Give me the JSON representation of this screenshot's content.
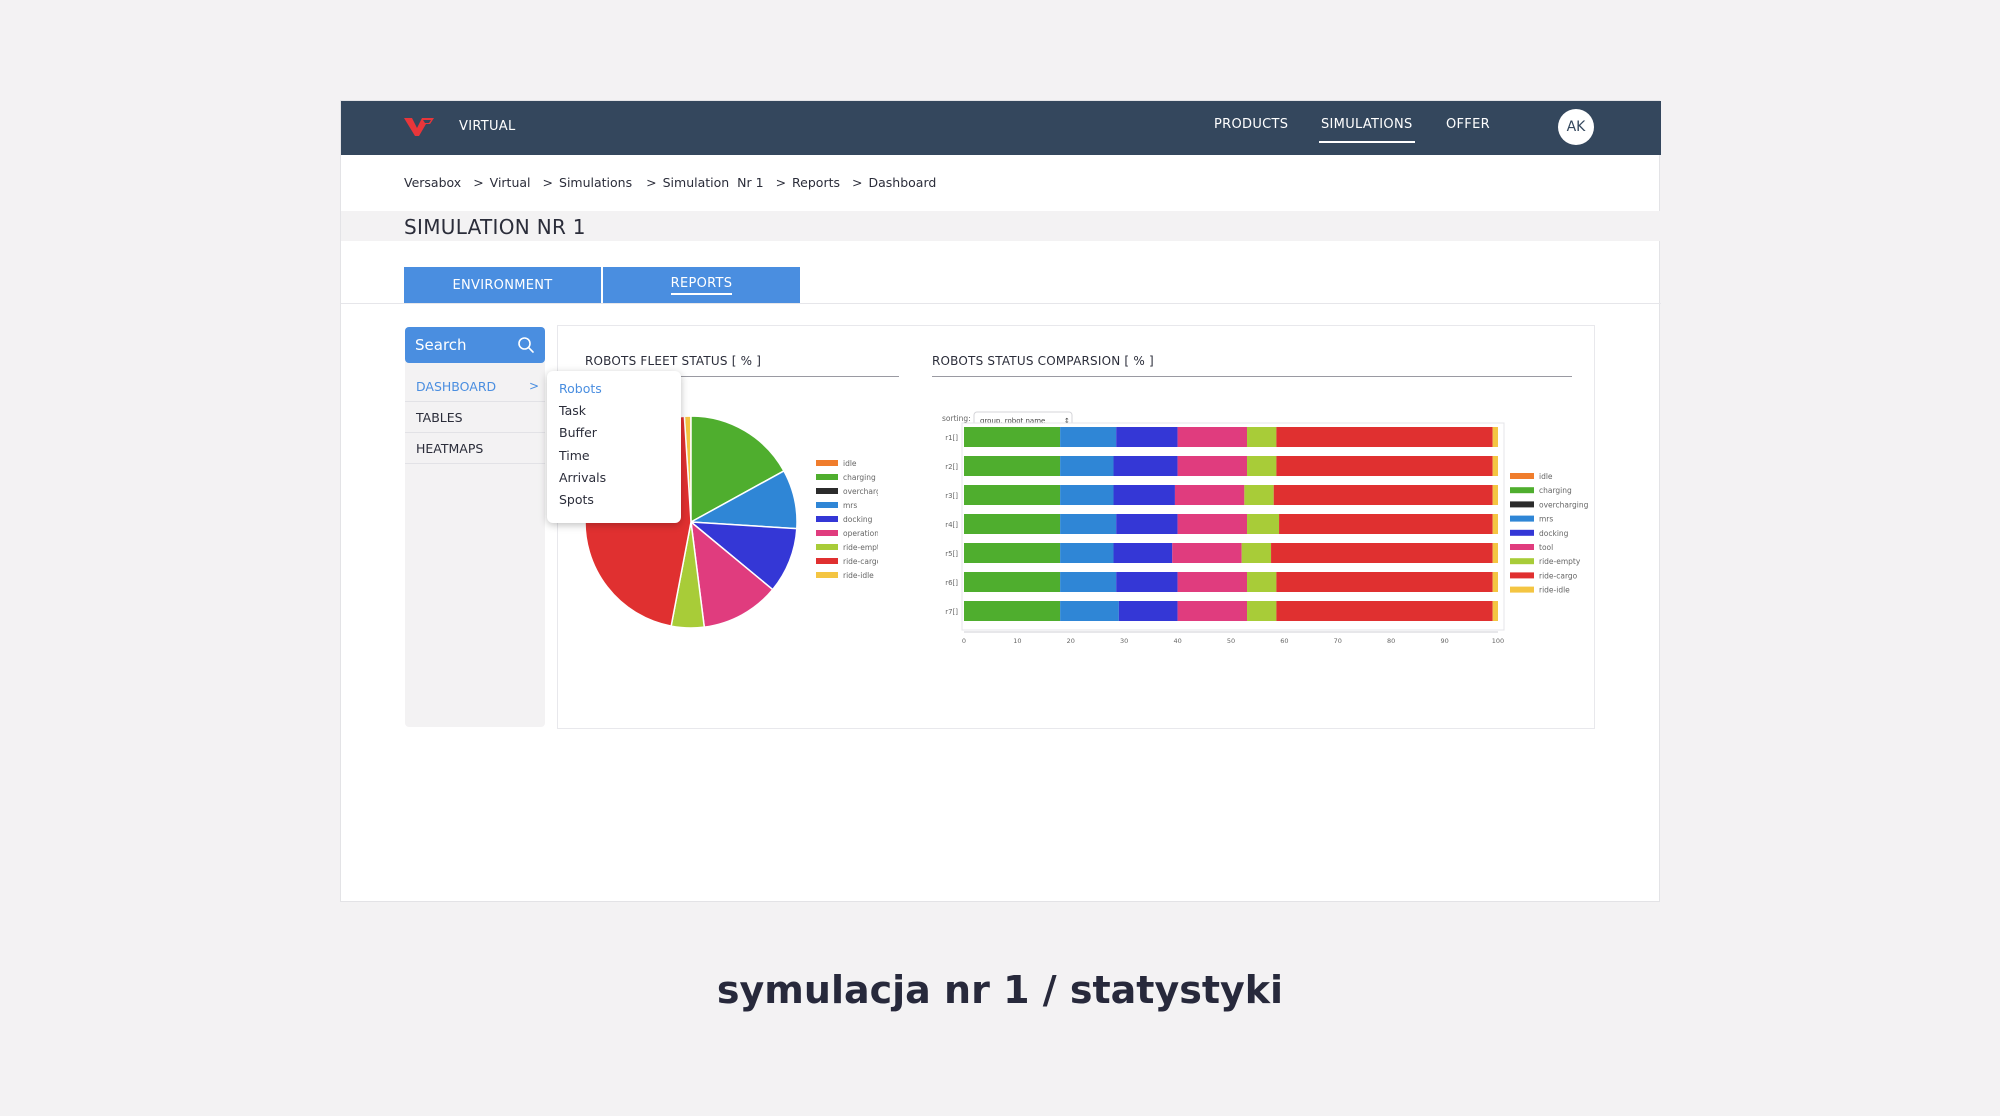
{
  "app": {
    "brand": "VIRTUAL",
    "user_initials": "AK"
  },
  "nav": [
    {
      "label": "PRODUCTS",
      "active": false
    },
    {
      "label": "SIMULATIONS",
      "active": true
    },
    {
      "label": "OFFER",
      "active": false
    }
  ],
  "breadcrumb": [
    "Versabox",
    "Virtual",
    "Simulations",
    "Simulation  Nr 1",
    "Reports",
    "Dashboard"
  ],
  "page_title": "SIMULATION NR 1",
  "tabs": [
    {
      "label": "ENVIRONMENT",
      "active": false
    },
    {
      "label": "REPORTS",
      "active": true
    }
  ],
  "sidebar": {
    "search_label": "Search",
    "items": [
      {
        "label": "DASHBOARD",
        "active": true
      },
      {
        "label": "TABLES",
        "active": false
      },
      {
        "label": "HEATMAPS",
        "active": false
      }
    ]
  },
  "dashboard_menu": [
    "Robots",
    "Task",
    "Buffer",
    "Time",
    "Arrivals",
    "Spots"
  ],
  "caption": "symulacja nr 1 / statystyki",
  "colors": {
    "topbar": "#34475d",
    "accent": "#4a8ee0"
  },
  "chart_data": [
    {
      "type": "pie",
      "title": "ROBOTS FLEET STATUS [ % ]",
      "categories": [
        "idle",
        "charging",
        "overcharging",
        "mrs",
        "docking",
        "operation",
        "ride-empty",
        "ride-cargo",
        "ride-idle"
      ],
      "values": [
        0,
        17,
        0,
        9,
        10,
        12,
        5,
        46,
        1
      ],
      "colors": [
        "#f07d2c",
        "#4fae2e",
        "#2b2b2b",
        "#2f86d6",
        "#3437d6",
        "#e03c7e",
        "#a8cc38",
        "#e03030",
        "#f4c542"
      ]
    },
    {
      "type": "bar",
      "orientation": "horizontal",
      "stacked": true,
      "title": "ROBOTS STATUS COMPARSION [ % ]",
      "sorting_label": "sorting:",
      "sorting_value": "group, robot name",
      "categories": [
        "r1[]",
        "r2[]",
        "r3[]",
        "r4[]",
        "r5[]",
        "r6[]",
        "r7[]"
      ],
      "xlim": [
        0,
        100
      ],
      "xticks": [
        0,
        10,
        20,
        30,
        40,
        50,
        60,
        70,
        80,
        90,
        100
      ],
      "series": [
        {
          "name": "charging",
          "color": "#4fae2e",
          "values": [
            18,
            18,
            18,
            18,
            18,
            18,
            18
          ]
        },
        {
          "name": "mrs",
          "color": "#2f86d6",
          "values": [
            10.5,
            10,
            10,
            10.5,
            10,
            10.5,
            11
          ]
        },
        {
          "name": "docking",
          "color": "#3437d6",
          "values": [
            11.5,
            12,
            11.5,
            11.5,
            11,
            11.5,
            11
          ]
        },
        {
          "name": "tool",
          "color": "#e03c7e",
          "values": [
            13,
            13,
            13,
            13,
            13,
            13,
            13
          ]
        },
        {
          "name": "ride-empty",
          "color": "#a8cc38",
          "values": [
            5.5,
            5.5,
            5.5,
            6,
            5.5,
            5.5,
            5.5
          ]
        },
        {
          "name": "ride-cargo",
          "color": "#e03030",
          "values": [
            40.5,
            40.5,
            41,
            40,
            41.5,
            40.5,
            40.5
          ]
        },
        {
          "name": "ride-idle",
          "color": "#f4c542",
          "values": [
            1,
            1,
            1,
            1,
            1,
            1,
            1
          ]
        }
      ],
      "legend": [
        {
          "name": "idle",
          "color": "#f07d2c"
        },
        {
          "name": "charging",
          "color": "#4fae2e"
        },
        {
          "name": "overcharging",
          "color": "#2b2b2b"
        },
        {
          "name": "mrs",
          "color": "#2f86d6"
        },
        {
          "name": "docking",
          "color": "#3437d6"
        },
        {
          "name": "tool",
          "color": "#e03c7e"
        },
        {
          "name": "ride-empty",
          "color": "#a8cc38"
        },
        {
          "name": "ride-cargo",
          "color": "#e03030"
        },
        {
          "name": "ride-idle",
          "color": "#f4c542"
        }
      ]
    }
  ]
}
